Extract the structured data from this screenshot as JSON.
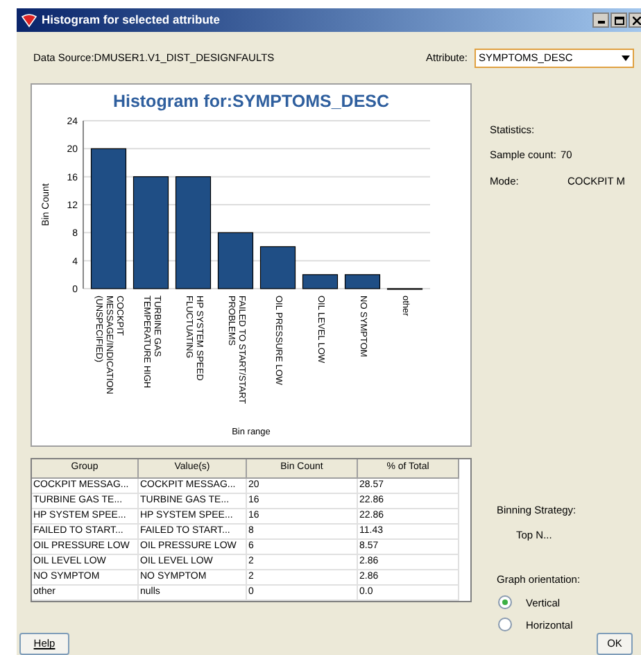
{
  "window": {
    "title": "Histogram for selected attribute"
  },
  "data_source": "Data Source:DMUSER1.V1_DIST_DESIGNFAULTS",
  "attribute": {
    "label": "Attribute:",
    "value": "SYMPTOMS_DESC"
  },
  "chart": {
    "chart_data": {
      "type": "bar",
      "title": "Histogram for:SYMPTOMS_DESC",
      "xlabel": "Bin range",
      "ylabel": "Bin Count",
      "categories": [
        "COCKPIT MESSAGE/INDICATION (UNSPECIFIED)",
        "TURBINE GAS TEMPERATURE HIGH",
        "HP SYSTEM SPEED FLUCTUATING",
        "FAILED TO START/START PROBLEMS",
        "OIL PRESSURE LOW",
        "OIL LEVEL LOW",
        "NO SYMPTOM",
        "other"
      ],
      "values": [
        20,
        16,
        16,
        8,
        6,
        2,
        2,
        0
      ],
      "grid": true,
      "ylim": [
        0,
        24
      ],
      "yticks": [
        0,
        4,
        8,
        12,
        16,
        20,
        24
      ]
    }
  },
  "table": {
    "columns": [
      "Group",
      "Value(s)",
      "Bin Count",
      "% of Total"
    ],
    "rows": [
      [
        "COCKPIT MESSAG...",
        "COCKPIT MESSAG...",
        "20",
        "28.57"
      ],
      [
        "TURBINE GAS TE...",
        "TURBINE GAS TE...",
        "16",
        "22.86"
      ],
      [
        "HP SYSTEM SPEE...",
        "HP SYSTEM SPEE...",
        "16",
        "22.86"
      ],
      [
        "FAILED TO START...",
        "FAILED TO START...",
        "8",
        "11.43"
      ],
      [
        "OIL PRESSURE LOW",
        "OIL PRESSURE LOW",
        "6",
        "8.57"
      ],
      [
        "OIL LEVEL LOW",
        "OIL LEVEL LOW",
        "2",
        "2.86"
      ],
      [
        "NO SYMPTOM",
        "NO SYMPTOM",
        "2",
        "2.86"
      ],
      [
        "other",
        "nulls",
        "0",
        "0.0"
      ]
    ]
  },
  "statistics": {
    "heading": "Statistics:",
    "sample_count_label": "Sample count:",
    "sample_count": "70",
    "mode_label": "Mode:",
    "mode": "COCKPIT M"
  },
  "binning": {
    "label": "Binning Strategy:",
    "value": "Top N..."
  },
  "orientation": {
    "label": "Graph orientation:",
    "options": [
      {
        "label": "Vertical",
        "selected": true
      },
      {
        "label": "Horizontal",
        "selected": false
      }
    ]
  },
  "buttons": {
    "help": "Help",
    "ok": "OK"
  }
}
